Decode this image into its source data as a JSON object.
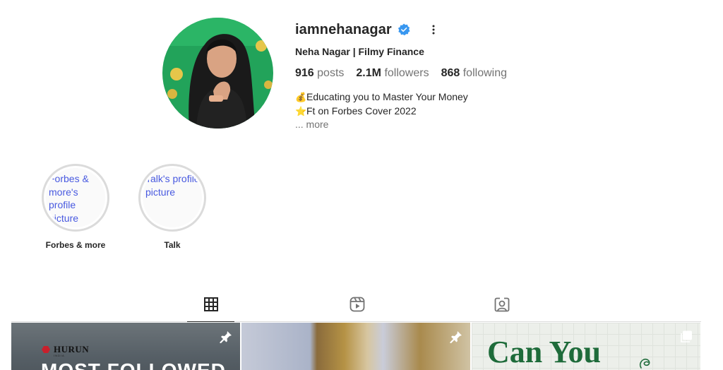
{
  "profile": {
    "username": "iamnehanagar",
    "full_name": "Neha Nagar | Filmy Finance",
    "verified_icon": "verified-badge-icon",
    "options_icon": "more-options-icon",
    "stats": {
      "posts_count": "916",
      "posts_label": "posts",
      "followers_count": "2.1M",
      "followers_label": "followers",
      "following_count": "868",
      "following_label": "following"
    },
    "bio": {
      "line1_emoji": "💰",
      "line1_text": "Educating you to Master Your Money",
      "line2_emoji": "⭐",
      "line2_text": "Ft on Forbes Cover 2022",
      "more": "... more"
    }
  },
  "highlights": [
    {
      "label": "Forbes & more",
      "alt": "Forbes & more's profile picture"
    },
    {
      "label": "Talk",
      "alt": "Talk's profile picture"
    }
  ],
  "tabs": [
    {
      "icon": "grid-icon",
      "active": true
    },
    {
      "icon": "reels-icon",
      "active": false
    },
    {
      "icon": "tagged-icon",
      "active": false
    }
  ],
  "posts": [
    {
      "brand": "HURUN",
      "brand_sub": "INDIA",
      "headline": "MOST FOLLOWED",
      "icon": "pin-icon"
    },
    {
      "icon": "pin-icon"
    },
    {
      "headline": "Can You",
      "icon": "carousel-icon"
    }
  ],
  "colors": {
    "accent_verified": "#3897f0",
    "link": "#4859e0",
    "muted_text": "#737373",
    "post3_headline": "#1e6b3a"
  }
}
